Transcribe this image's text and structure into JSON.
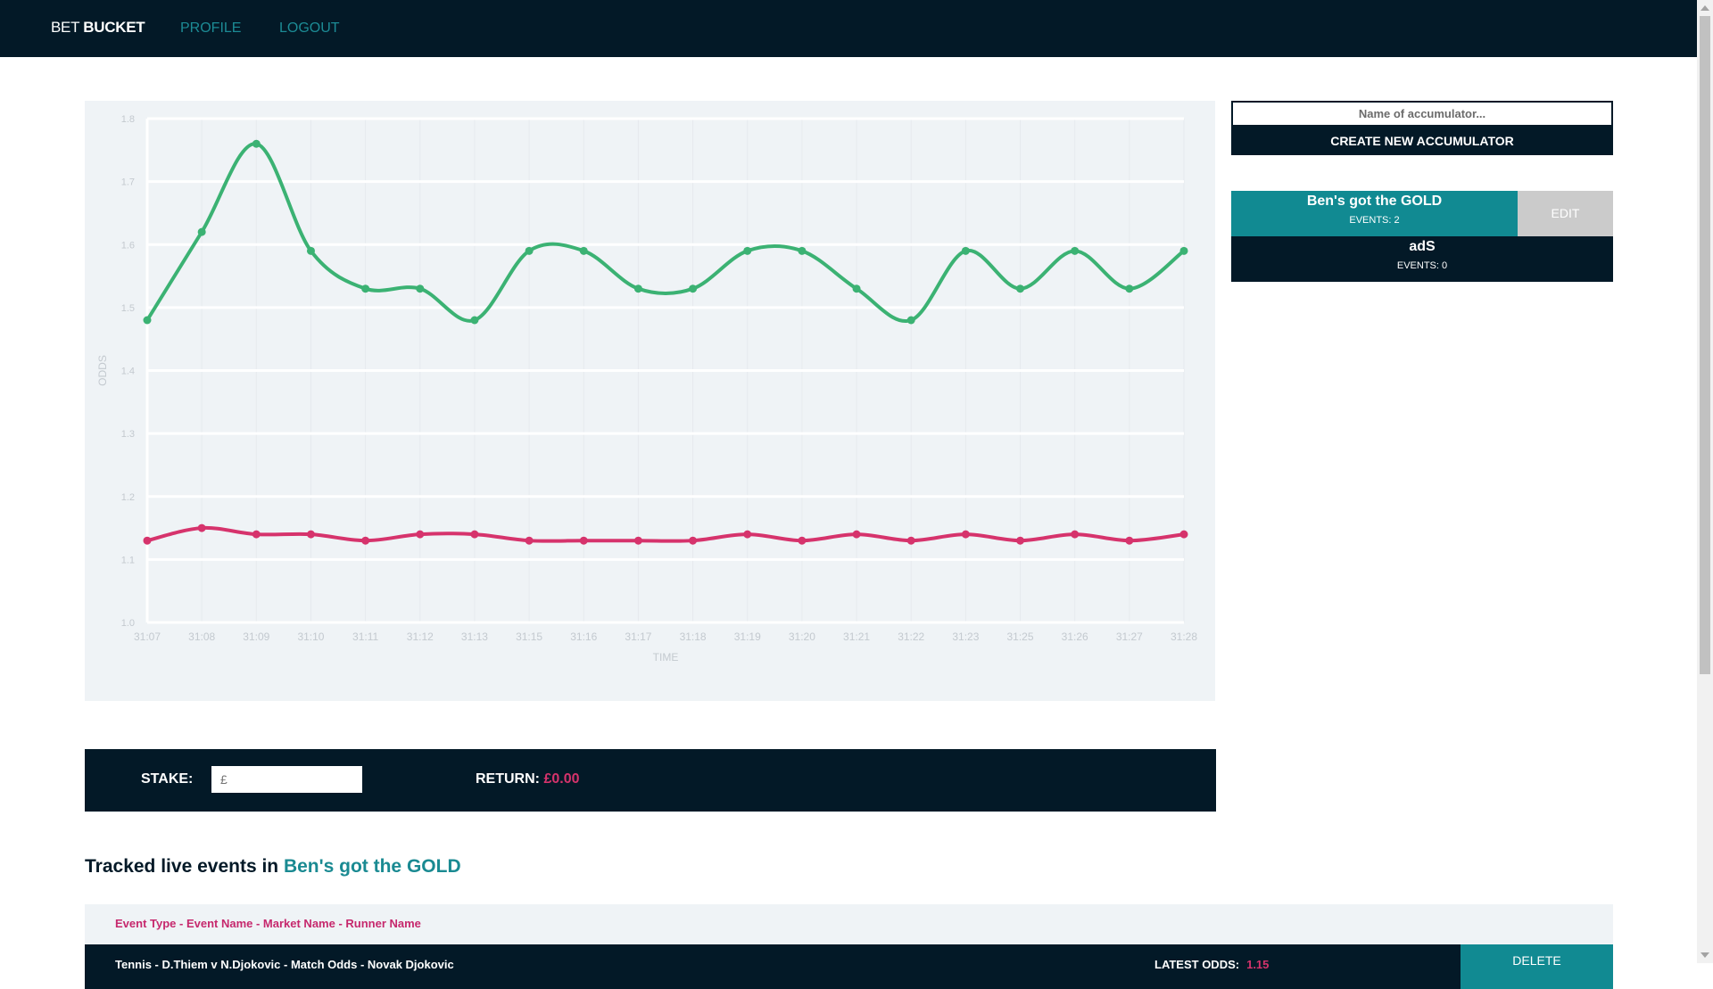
{
  "nav": {
    "brand_part1": "BET ",
    "brand_part2": "BUCKET",
    "profile": "PROFILE",
    "logout": "LOGOUT"
  },
  "colors": {
    "navy": "#031927",
    "teal": "#118a92",
    "pink": "#d6336c",
    "green": "#3bb273",
    "panel_bg": "#eff3f6"
  },
  "chart_data": {
    "type": "line",
    "title": "",
    "xlabel": "TIME",
    "ylabel": "ODDS",
    "ylim": [
      1.0,
      1.8
    ],
    "yticks": [
      "1.0",
      "1.1",
      "1.2",
      "1.3",
      "1.4",
      "1.5",
      "1.6",
      "1.7",
      "1.8"
    ],
    "grid": true,
    "categories": [
      "31:07",
      "31:08",
      "31:09",
      "31:10",
      "31:11",
      "31:12",
      "31:13",
      "31:15",
      "31:16",
      "31:17",
      "31:18",
      "31:19",
      "31:20",
      "31:21",
      "31:22",
      "31:23",
      "31:25",
      "31:26",
      "31:27",
      "31:28"
    ],
    "series": [
      {
        "color": "#3bb273",
        "values": [
          1.48,
          1.62,
          1.76,
          1.59,
          1.53,
          1.53,
          1.48,
          1.59,
          1.59,
          1.53,
          1.53,
          1.59,
          1.59,
          1.53,
          1.48,
          1.59,
          1.53,
          1.59,
          1.53,
          1.59
        ]
      },
      {
        "color": "#d6336c",
        "values": [
          1.13,
          1.15,
          1.14,
          1.14,
          1.13,
          1.14,
          1.14,
          1.13,
          1.13,
          1.13,
          1.13,
          1.14,
          1.13,
          1.14,
          1.13,
          1.14,
          1.13,
          1.14,
          1.13,
          1.14
        ]
      }
    ]
  },
  "accumulator_form": {
    "placeholder": "Name of accumulator...",
    "create_label": "CREATE NEW ACCUMULATOR"
  },
  "accumulators": [
    {
      "name": "Ben's got the GOLD",
      "events": "EVENTS: 2",
      "edit_label": "EDIT",
      "bg": "#118a92"
    },
    {
      "name": "adS",
      "events": "EVENTS: 0",
      "bg": "#031927"
    }
  ],
  "stake": {
    "label": "STAKE:",
    "placeholder": "£",
    "return_label": "RETURN:",
    "return_value": "£0.00"
  },
  "tracked": {
    "prefix": "Tracked live events in ",
    "accumulator": "Ben's got the GOLD",
    "header": "Event Type - Event Name - Market Name - Runner Name",
    "rows": [
      {
        "event": "Tennis - D.Thiem v N.Djokovic - Match Odds - Novak Djokovic",
        "odds_label": "LATEST ODDS:",
        "odds_value": "1.15",
        "delete_label": "DELETE"
      }
    ]
  }
}
